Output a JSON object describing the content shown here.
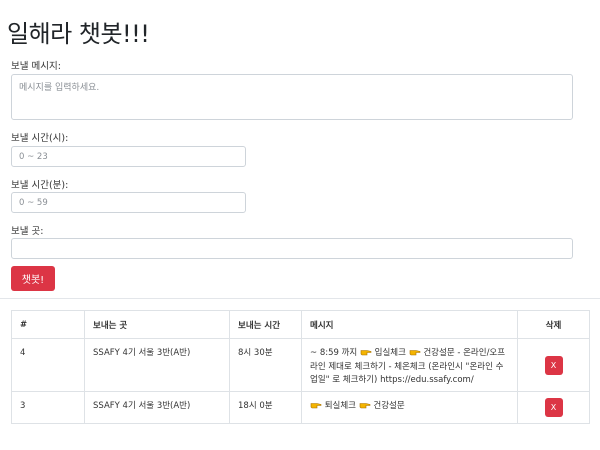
{
  "page": {
    "title": "일해라 챗봇!!!"
  },
  "form": {
    "message_label": "보낼 메시지:",
    "message_placeholder": "메시지를 입력하세요.",
    "hour_label": "보낼 시간(시):",
    "hour_placeholder": "0 ~ 23",
    "minute_label": "보낼 시간(분):",
    "minute_placeholder": "0 ~ 59",
    "target_label": "보낼 곳:",
    "target_value": "",
    "submit_label": "챗봇!"
  },
  "table": {
    "headers": [
      "#",
      "보내는 곳",
      "보내는 시간",
      "메시지",
      "삭제"
    ],
    "rows": [
      {
        "id": "4",
        "target": "SSAFY 4기 서울 3반(A반)",
        "time": "8시 30분",
        "msg_a": "~ 8:59 까지 ",
        "msg_b": " 입실체크 ",
        "msg_c": " 건강설문 - 온라인/오프라인 제대로 체크하기 - 체온체크 (온라인시 \"온라인 수업일\" 로 체크하기) https://edu.ssafy.com/",
        "delete_label": "X"
      },
      {
        "id": "3",
        "target": "SSAFY 4기 서울 3반(A반)",
        "time": "18시 0분",
        "msg_a": "",
        "msg_b": " 퇴실체크 ",
        "msg_c": " 건강설문",
        "delete_label": "X"
      }
    ]
  },
  "icons": {
    "hand": "pointing-hand-icon",
    "hand_color": "#f4b400"
  },
  "colors": {
    "danger": "#dc3545",
    "border": "#dee2e6"
  }
}
